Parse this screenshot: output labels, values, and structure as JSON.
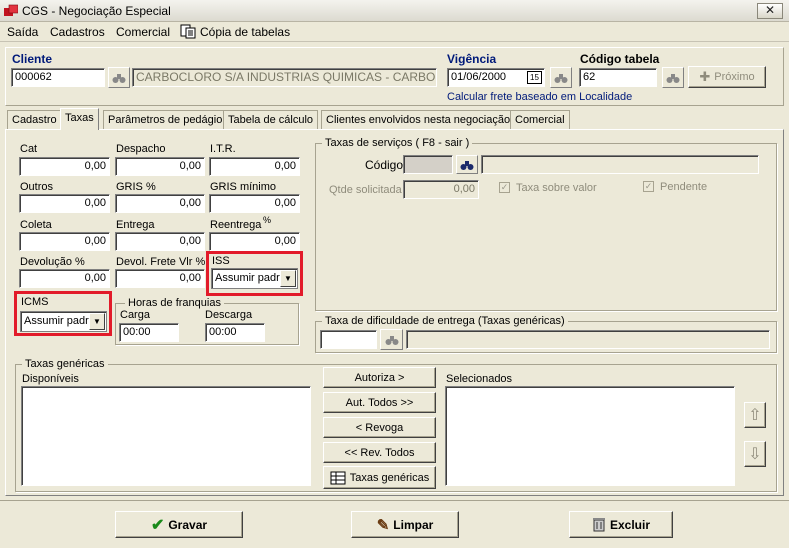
{
  "window": {
    "title": "CGS - Negociação Especial",
    "close_glyph": "✕"
  },
  "menu": {
    "saida": "Saída",
    "cadastros": "Cadastros",
    "comercial": "Comercial",
    "copia": "Cópia de tabelas"
  },
  "header": {
    "cliente_label": "Cliente",
    "cliente_code": "000062",
    "cliente_name": "CARBOCLORO S/A INDUSTRIAS QUIMICAS  -  CARBOCLOR",
    "vigencia_label": "Vigência",
    "vigencia_value": "01/06/2000",
    "calendar_glyph": "15",
    "codigo_label": "Código tabela",
    "codigo_value": "62",
    "proximo_label": "Próximo",
    "frete_info": "Calcular frete baseado em Localidade"
  },
  "tabs": [
    "Cadastro",
    "Taxas",
    "Parâmetros de pedágio",
    "Tabela de cálculo",
    "Clientes envolvidos nesta negociação",
    "Comercial"
  ],
  "taxas": {
    "cat_label": "Cat",
    "cat_value": "0,00",
    "despacho_label": "Despacho",
    "despacho_value": "0,00",
    "itr_label": "I.T.R.",
    "itr_value": "0,00",
    "outros_label": "Outros",
    "outros_value": "0,00",
    "gris_label": "GRIS  %",
    "gris_value": "0,00",
    "grismin_label": "GRIS mínimo",
    "grismin_value": "0,00",
    "coleta_label": "Coleta",
    "coleta_value": "0,00",
    "entrega_label": "Entrega",
    "entrega_value": "0,00",
    "reentrega_label": "Reentrega",
    "reentrega_pct": "%",
    "reentrega_value": "0,00",
    "devolucao_label": "Devolução %",
    "devolucao_value": "0,00",
    "devfrete_label": "Devol. Frete Vlr %",
    "devfrete_value": "0,00",
    "iss_label": "ISS",
    "iss_value": "Assumir padrã",
    "icms_label": "ICMS",
    "icms_value": "Assumir padrã",
    "franquias_label": "Horas de franquias",
    "carga_label": "Carga",
    "carga_value": "00:00",
    "descarga_label": "Descarga",
    "descarga_value": "00:00"
  },
  "servicos": {
    "title": "Taxas de serviços  ( F8 - sair )",
    "codigo_label": "Código",
    "qtde_label": "Qtde solicitada",
    "qtde_value": "0,00",
    "taxa_valor_label": "Taxa sobre valor",
    "pendente_label": "Pendente"
  },
  "dificuldade": {
    "title": "Taxa de dificuldade de entrega (Taxas genéricas)"
  },
  "genericas": {
    "title": "Taxas genéricas",
    "disponiveis_label": "Disponíveis",
    "selecionados_label": "Selecionados",
    "autoriza": "Autoriza >",
    "aut_todos": "Aut. Todos >>",
    "revoga": "< Revoga",
    "rev_todos": "<< Rev. Todos",
    "taxas_genericas": "Taxas genéricas",
    "up_glyph": "⇧",
    "down_glyph": "⇩"
  },
  "footer": {
    "gravar": "Gravar",
    "limpar": "Limpar",
    "excluir": "Excluir"
  }
}
